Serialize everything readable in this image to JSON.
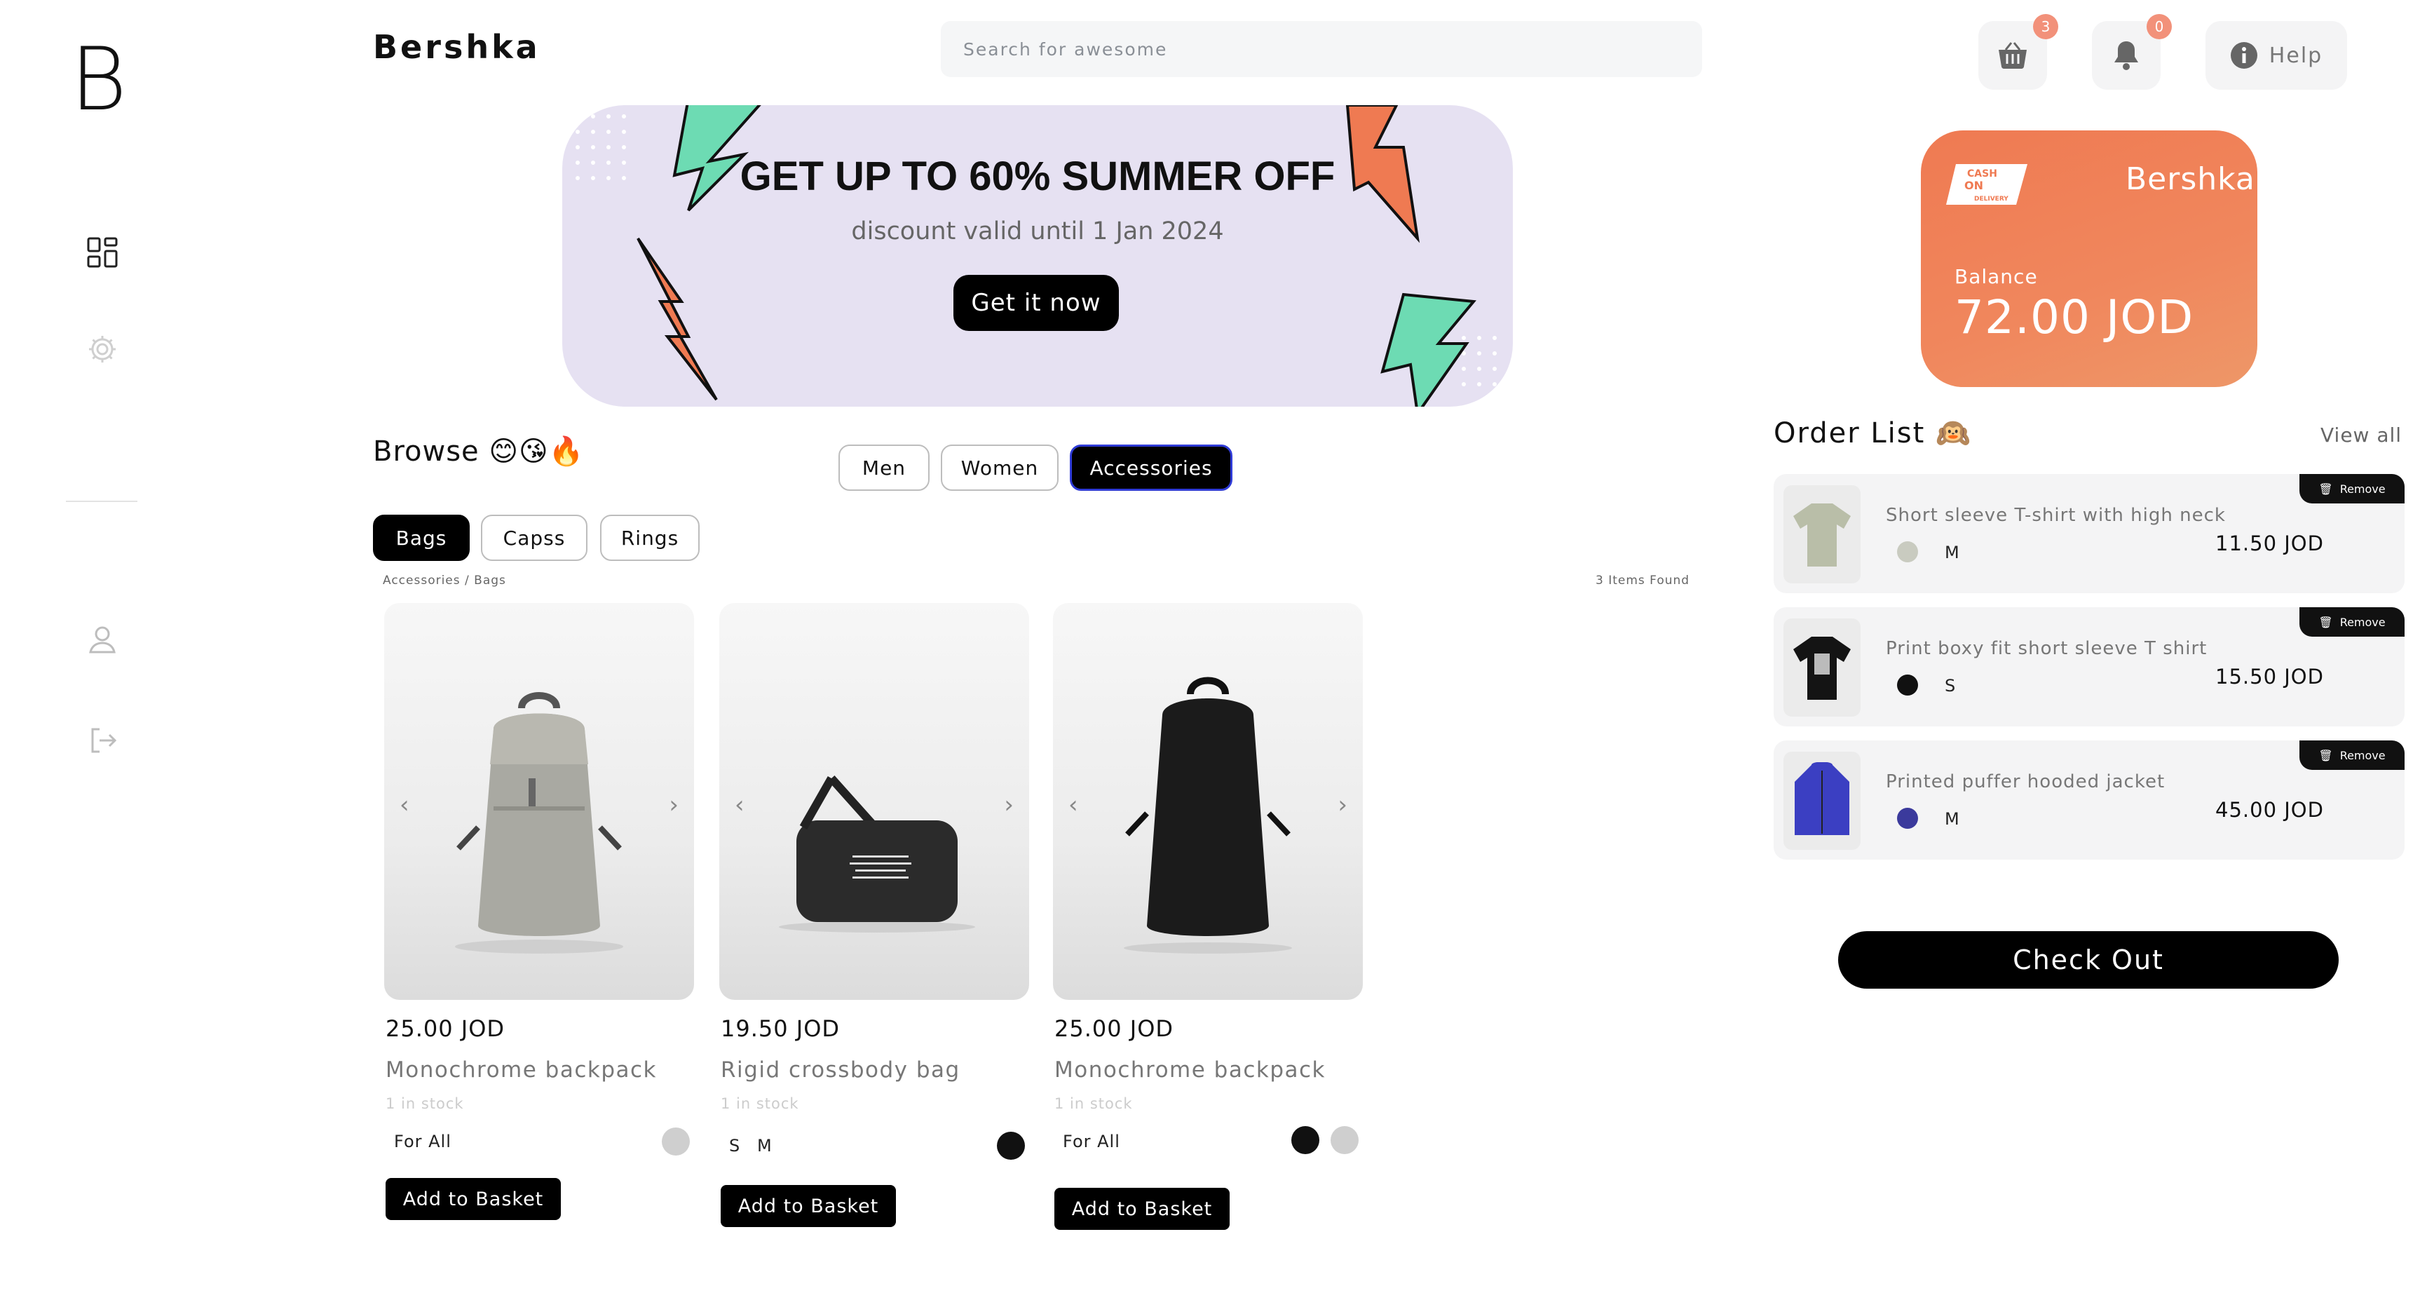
{
  "logo": "B",
  "brand": "Bershka",
  "search": {
    "placeholder": "Search for awesome"
  },
  "header": {
    "basket_count": "3",
    "notification_count": "0",
    "help_label": "Help"
  },
  "banner": {
    "title": "GET UP TO 60% SUMMER OFF",
    "subtitle": "discount valid until 1 Jan 2024",
    "button_label": "Get it now"
  },
  "browse": {
    "title": "Browse 😊😘🔥",
    "gender_tabs": [
      "Men",
      "Women",
      "Accessories"
    ],
    "active_gender_tab": "Accessories",
    "category_tabs": [
      "Bags",
      "Capss",
      "Rings"
    ],
    "active_category_tab": "Bags",
    "breadcrumb": "Accessories / Bags",
    "items_found": "3 Items Found"
  },
  "products": [
    {
      "price": "25.00 JOD",
      "name": "Monochrome backpack",
      "stock": "1 in stock",
      "tag": "For All",
      "sizes": [],
      "colors": [
        "#cfcfcf"
      ],
      "add_label": "Add to Basket"
    },
    {
      "price": "19.50 JOD",
      "name": "Rigid crossbody bag",
      "stock": "1 in stock",
      "tag": "",
      "sizes": [
        "S",
        "M"
      ],
      "colors": [
        "#111111"
      ],
      "add_label": "Add to Basket"
    },
    {
      "price": "25.00 JOD",
      "name": "Monochrome backpack",
      "stock": "1 in stock",
      "tag": "For All",
      "sizes": [],
      "colors": [
        "#111111",
        "#cfcfcf"
      ],
      "add_label": "Add to Basket"
    }
  ],
  "wallet": {
    "badge_lines": [
      "CASH",
      "ON",
      "DELIVERY"
    ],
    "brand": "Bershka",
    "balance_label": "Balance",
    "balance": "72.00 JOD"
  },
  "order_list": {
    "title": "Order List 🙉",
    "view_all": "View all",
    "remove_label": "Remove",
    "items": [
      {
        "name": "Short sleeve T-shirt with high neck",
        "color": "#c9cbc0",
        "size": "M",
        "price": "11.50 JOD"
      },
      {
        "name": "Print boxy fit short sleeve T shirt",
        "color": "#111111",
        "size": "S",
        "price": "15.50 JOD"
      },
      {
        "name": "Printed puffer hooded jacket",
        "color": "#3b3a9c",
        "size": "M",
        "price": "45.00 JOD"
      }
    ]
  },
  "checkout_label": "Check Out",
  "colors": {
    "accent_orange": "#ef7a52",
    "badge": "#f2917a",
    "banner_bg": "#e6e1f2",
    "active_outline": "#2f3bd6"
  }
}
